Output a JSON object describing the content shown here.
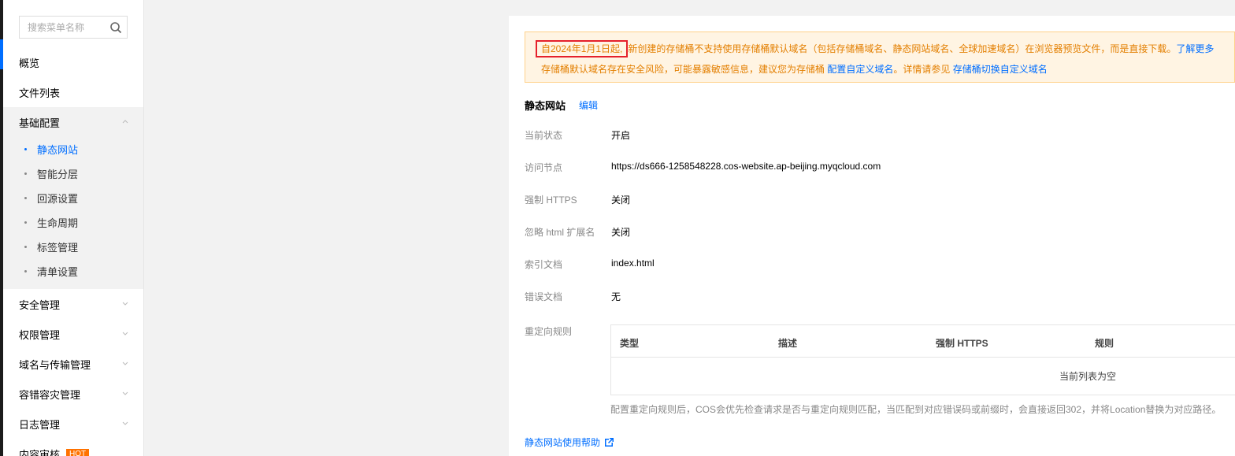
{
  "search": {
    "placeholder": "搜索菜单名称"
  },
  "nav": {
    "overview": "概览",
    "file_list": "文件列表",
    "basic_config": "基础配置",
    "sub_items": [
      "静态网站",
      "智能分层",
      "回源设置",
      "生命周期",
      "标签管理",
      "清单设置"
    ],
    "security": "安全管理",
    "permission": "权限管理",
    "domain": "域名与传输管理",
    "disaster": "容错容灾管理",
    "log": "日志管理",
    "content_audit": "内容审核",
    "content_audit_badge": "HOT"
  },
  "notice": {
    "date": "自2024年1月1日起,",
    "line1_rest": "新创建的存储桶不支持使用存储桶默认域名（包括存储桶域名、静态网站域名、全球加速域名）在浏览器预览文件，而是直接下载。",
    "learn_more": "了解更多",
    "line2_text": "存储桶默认域名存在安全风险，可能暴露敏感信息，建议您为存储桶 ",
    "custom_domain": "配置自定义域名",
    "line2_mid": "。详情请参见 ",
    "switch_domain": "存储桶切换自定义域名"
  },
  "section": {
    "title": "静态网站",
    "edit": "编辑"
  },
  "fields": {
    "status_label": "当前状态",
    "status_value": "开启",
    "endpoint_label": "访问节点",
    "endpoint_value": "https://ds666-1258548228.cos-website.ap-beijing.myqcloud.com",
    "https_label": "强制 HTTPS",
    "https_value": "关闭",
    "ignore_label": "忽略 html 扩展名",
    "ignore_value": "关闭",
    "index_label": "索引文档",
    "index_value": "index.html",
    "error_label": "错误文档",
    "error_value": "无",
    "redirect_label": "重定向规则"
  },
  "redirect_table": {
    "headers": [
      "类型",
      "描述",
      "强制 HTTPS",
      "规则"
    ],
    "empty": "当前列表为空"
  },
  "hint": "配置重定向规则后，COS会优先检查请求是否与重定向规则匹配，当匹配到对应错误码或前缀时，会直接返回302，并将Location替换为对应路径。",
  "help": "静态网站使用帮助"
}
